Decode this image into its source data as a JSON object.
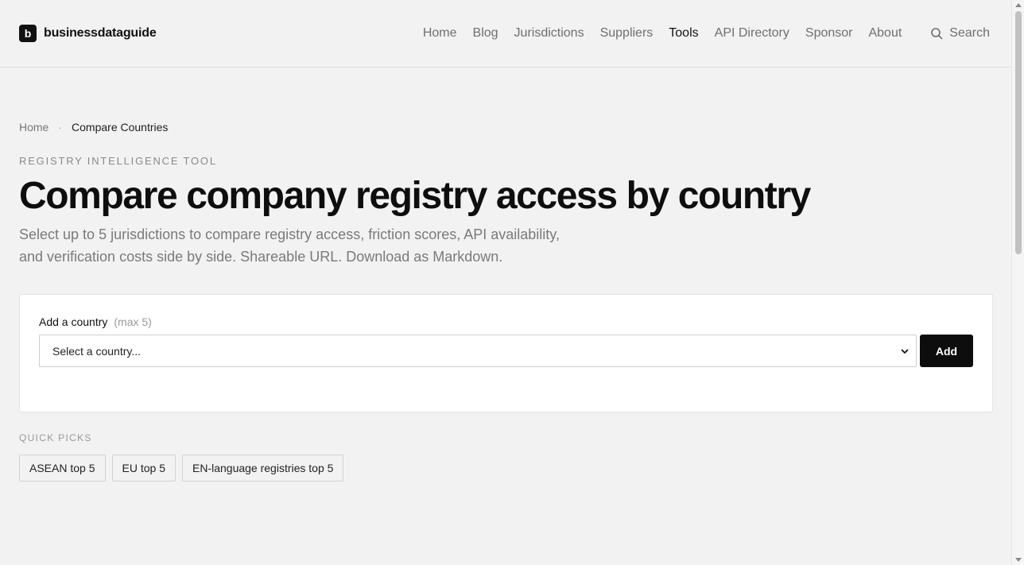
{
  "header": {
    "logo_letter": "b",
    "brand_name": "businessdataguide",
    "nav": [
      {
        "label": "Home",
        "active": false
      },
      {
        "label": "Blog",
        "active": false
      },
      {
        "label": "Jurisdictions",
        "active": false
      },
      {
        "label": "Suppliers",
        "active": false
      },
      {
        "label": "Tools",
        "active": true
      },
      {
        "label": "API Directory",
        "active": false
      },
      {
        "label": "Sponsor",
        "active": false
      },
      {
        "label": "About",
        "active": false
      }
    ],
    "search_label": "Search",
    "search_icon": "search-icon"
  },
  "breadcrumb": {
    "home": "Home",
    "separator": "·",
    "current": "Compare Countries"
  },
  "hero": {
    "eyebrow": "REGISTRY INTELLIGENCE TOOL",
    "title": "Compare company registry access by country",
    "lead": "Select up to 5 jurisdictions to compare registry access, friction scores, API availability, and verification costs side by side. Shareable URL. Download as Markdown."
  },
  "form": {
    "label": "Add a country",
    "hint": "(max 5)",
    "select_value": "Select a country...",
    "add_label": "Add"
  },
  "quick_picks": {
    "label": "QUICK PICKS",
    "items": [
      "ASEAN top 5",
      "EU top 5",
      "EN-language registries top 5"
    ]
  },
  "colors": {
    "background": "#f2f2f2",
    "text": "#111111",
    "muted": "#7a7a7a",
    "button": "#0d0d0d"
  }
}
